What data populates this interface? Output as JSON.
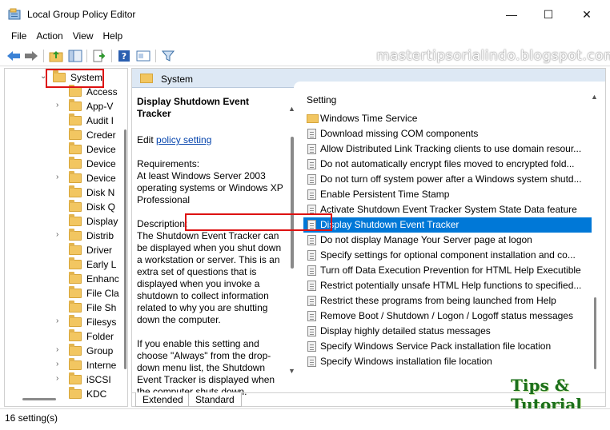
{
  "window": {
    "title": "Local Group Policy Editor",
    "minimize": "—",
    "maximize": "☐",
    "close": "✕"
  },
  "menu": [
    "File",
    "Action",
    "View",
    "Help"
  ],
  "watermark": "mastertipsorialindo.blogspot.com",
  "tree": {
    "items": [
      {
        "label": "System",
        "arrow": "⌄"
      },
      {
        "label": "Access",
        "arrow": ""
      },
      {
        "label": "App-V",
        "arrow": "›"
      },
      {
        "label": "Audit I",
        "arrow": ""
      },
      {
        "label": "Creder",
        "arrow": ""
      },
      {
        "label": "Device",
        "arrow": ""
      },
      {
        "label": "Device",
        "arrow": ""
      },
      {
        "label": "Device",
        "arrow": "›"
      },
      {
        "label": "Disk N",
        "arrow": ""
      },
      {
        "label": "Disk Q",
        "arrow": ""
      },
      {
        "label": "Display",
        "arrow": ""
      },
      {
        "label": "Distrib",
        "arrow": "›"
      },
      {
        "label": "Driver",
        "arrow": ""
      },
      {
        "label": "Early L",
        "arrow": ""
      },
      {
        "label": "Enhanc",
        "arrow": ""
      },
      {
        "label": "File Cla",
        "arrow": ""
      },
      {
        "label": "File Sh",
        "arrow": ""
      },
      {
        "label": "Filesys",
        "arrow": "›"
      },
      {
        "label": "Folder",
        "arrow": ""
      },
      {
        "label": "Group",
        "arrow": "›"
      },
      {
        "label": "Interne",
        "arrow": "›"
      },
      {
        "label": "iSCSI",
        "arrow": "›"
      },
      {
        "label": "KDC",
        "arrow": ""
      }
    ]
  },
  "right_pane": {
    "header": "System",
    "description": {
      "title": "Display Shutdown Event Tracker",
      "edit_prefix": "Edit ",
      "edit_link": "policy setting",
      "requirements_label": "Requirements:",
      "requirements": "At least Windows Server 2003 operating systems or Windows XP Professional",
      "description_label": "Description:",
      "description": "The Shutdown Event Tracker can be displayed when you shut down a workstation or server.  This is an extra set of questions that is displayed when you invoke a shutdown to collect information related to why you are shutting down the computer.",
      "enable_text": "If you enable this setting and choose \"Always\" from the drop-down menu list, the Shutdown Event Tracker is displayed when the computer shuts down."
    },
    "column_header": "Setting",
    "settings": [
      {
        "label": "Windows Time Service",
        "type": "folder"
      },
      {
        "label": "Download missing COM components",
        "type": "policy"
      },
      {
        "label": "Allow Distributed Link Tracking clients to use domain resour...",
        "type": "policy"
      },
      {
        "label": "Do not automatically encrypt files moved to encrypted fold...",
        "type": "policy"
      },
      {
        "label": "Do not turn off system power after a Windows system shutd...",
        "type": "policy"
      },
      {
        "label": "Enable Persistent Time Stamp",
        "type": "policy"
      },
      {
        "label": "Activate Shutdown Event Tracker System State Data feature",
        "type": "policy"
      },
      {
        "label": "Display Shutdown Event Tracker",
        "type": "policy",
        "selected": true
      },
      {
        "label": "Do not display Manage Your Server page at logon",
        "type": "policy"
      },
      {
        "label": "Specify settings for optional component installation and co...",
        "type": "policy"
      },
      {
        "label": "Turn off Data Execution Prevention for HTML Help Executible",
        "type": "policy"
      },
      {
        "label": "Restrict potentially unsafe HTML Help functions to specified...",
        "type": "policy"
      },
      {
        "label": "Restrict these programs from being launched from Help",
        "type": "policy"
      },
      {
        "label": "Remove Boot / Shutdown / Logon / Logoff status messages",
        "type": "policy"
      },
      {
        "label": "Display highly detailed status messages",
        "type": "policy"
      },
      {
        "label": "Specify Windows Service Pack installation file location",
        "type": "policy"
      },
      {
        "label": "Specify Windows installation file location",
        "type": "policy"
      }
    ],
    "tabs": [
      "Extended",
      "Standard"
    ],
    "active_tab": "Extended"
  },
  "logo": "Tips & Tutorial",
  "status": "16 setting(s)",
  "colors": {
    "selection": "#0078d7",
    "highlight_box": "#d11111",
    "link": "#0645ad"
  }
}
